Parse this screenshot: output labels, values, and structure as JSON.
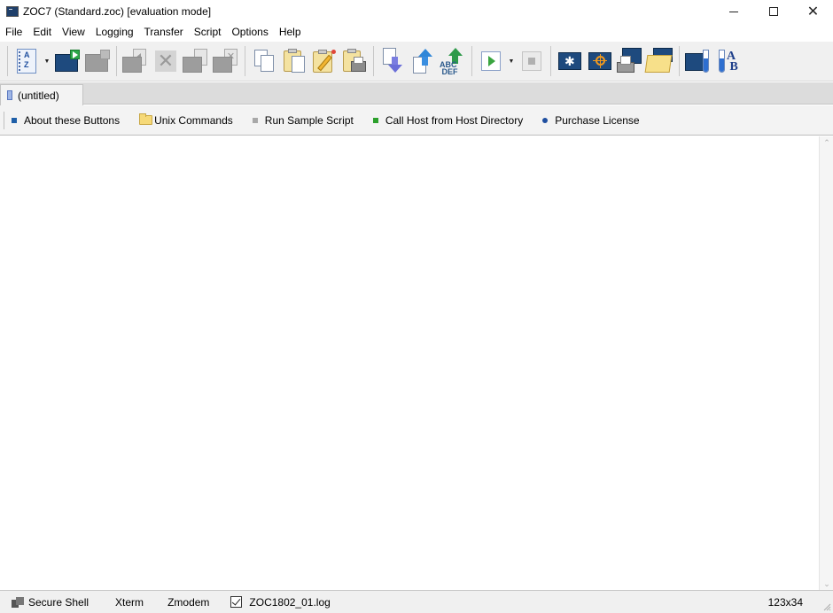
{
  "window": {
    "title": "ZOC7 (Standard.zoc) [evaluation mode]",
    "controls": {
      "minimize": "minimize",
      "maximize": "maximize",
      "close": "close"
    }
  },
  "menu": {
    "items": [
      "File",
      "Edit",
      "View",
      "Logging",
      "Transfer",
      "Script",
      "Options",
      "Help"
    ]
  },
  "toolbar": {
    "buttons": [
      {
        "name": "host-directory",
        "icon": "address-book-icon",
        "enabled": true
      },
      {
        "name": "quick-connect",
        "icon": "terminal-play-icon",
        "enabled": true
      },
      {
        "name": "disconnect",
        "icon": "terminal-stop-icon",
        "enabled": false
      },
      {
        "name": "previous-session",
        "icon": "session-back-icon",
        "enabled": false
      },
      {
        "name": "close-session",
        "icon": "close-x-icon",
        "enabled": false
      },
      {
        "name": "session-document",
        "icon": "session-doc-icon",
        "enabled": false
      },
      {
        "name": "close-all-sessions",
        "icon": "session-close-icon",
        "enabled": false
      },
      {
        "name": "copy",
        "icon": "copy-icon",
        "enabled": true
      },
      {
        "name": "paste",
        "icon": "paste-icon",
        "enabled": true
      },
      {
        "name": "edit-clipboard",
        "icon": "clipboard-edit-icon",
        "enabled": true
      },
      {
        "name": "print-clipboard",
        "icon": "clipboard-print-icon",
        "enabled": true
      },
      {
        "name": "download",
        "icon": "download-icon",
        "enabled": true
      },
      {
        "name": "upload",
        "icon": "upload-icon",
        "enabled": true
      },
      {
        "name": "send-text",
        "icon": "abc-upload-icon",
        "enabled": true
      },
      {
        "name": "run-script",
        "icon": "play-icon",
        "enabled": true
      },
      {
        "name": "stop-script",
        "icon": "stop-icon",
        "enabled": false
      },
      {
        "name": "clear-screen",
        "icon": "sparkle-screen-icon",
        "enabled": true
      },
      {
        "name": "target-screen",
        "icon": "crosshair-screen-icon",
        "enabled": true
      },
      {
        "name": "print-screen",
        "icon": "screen-print-icon",
        "enabled": true
      },
      {
        "name": "open-folder",
        "icon": "screen-folder-icon",
        "enabled": true
      },
      {
        "name": "terminal-emulation",
        "icon": "terminal-testtube-icon",
        "enabled": true
      },
      {
        "name": "font-settings",
        "icon": "testtube-ab-icon",
        "enabled": true
      }
    ]
  },
  "tabs": [
    {
      "label": "(untitled)",
      "active": true
    }
  ],
  "button_bar": {
    "items": [
      {
        "label": "About these Buttons",
        "marker": "square",
        "color": "#1f5fa8"
      },
      {
        "label": "Unix Commands",
        "marker": "folder",
        "color": "#f6d978"
      },
      {
        "label": "Run Sample Script",
        "marker": "square",
        "color": "#a8a8a8"
      },
      {
        "label": "Call Host from Host Directory",
        "marker": "square",
        "color": "#2ca02c"
      },
      {
        "label": "Purchase License",
        "marker": "dot",
        "color": "#1f4fa0"
      }
    ]
  },
  "terminal": {
    "content": ""
  },
  "status": {
    "connection": "Secure Shell",
    "emulation": "Xterm",
    "transfer": "Zmodem",
    "log_enabled": true,
    "log_file": "ZOC1802_01.log",
    "size": "123x34"
  }
}
